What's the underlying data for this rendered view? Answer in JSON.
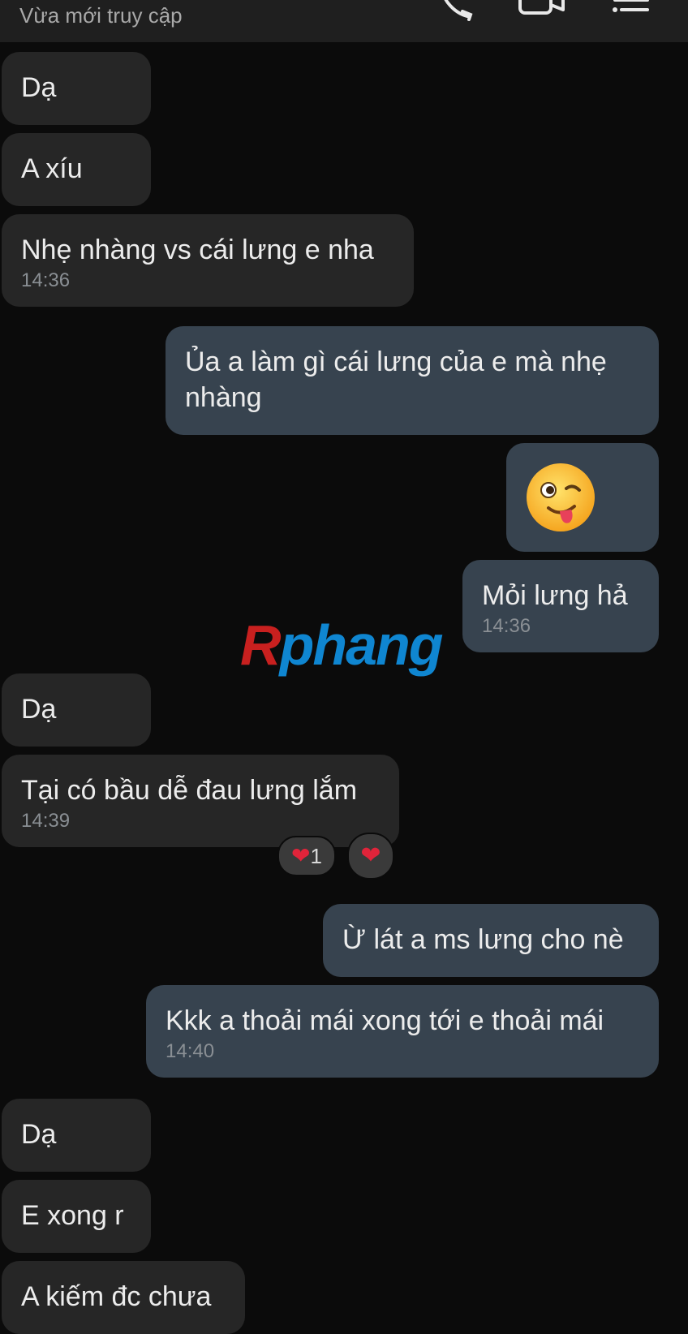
{
  "header": {
    "status": "Vừa mới truy cập",
    "icons": [
      "phone-icon",
      "video-call-icon",
      "menu-icon"
    ]
  },
  "messages": [
    {
      "id": "m1",
      "side": "in",
      "text": "Dạ"
    },
    {
      "id": "m2",
      "side": "in",
      "text": "A xíu"
    },
    {
      "id": "m3",
      "side": "in",
      "text": "Nhẹ nhàng vs cái lưng e nha",
      "time": "14:36"
    },
    {
      "id": "m4",
      "side": "out",
      "text": "Ủa a làm gì cái lưng của e mà nhẹ nhàng"
    },
    {
      "id": "m5",
      "side": "out",
      "emoji": "winking-face-with-tongue"
    },
    {
      "id": "m6",
      "side": "out",
      "text": "Mỏi lưng hả",
      "time": "14:36"
    },
    {
      "id": "m7",
      "side": "in",
      "text": "Dạ"
    },
    {
      "id": "m8",
      "side": "in",
      "text": "Tại có bầu dễ đau lưng lắm",
      "time": "14:39",
      "reactions": {
        "heart_count": "1"
      }
    },
    {
      "id": "m9",
      "side": "out",
      "text": "Ừ lát a ms lưng cho nè"
    },
    {
      "id": "m10",
      "side": "out",
      "text": "Kkk a thoải mái xong tới e thoải mái",
      "time": "14:40"
    },
    {
      "id": "m11",
      "side": "in",
      "text": "Dạ"
    },
    {
      "id": "m12",
      "side": "in",
      "text": "E xong r"
    },
    {
      "id": "m13",
      "side": "in",
      "text": "A kiếm đc chưa"
    }
  ],
  "watermark": {
    "part1": "R",
    "part2": "phang"
  },
  "colors": {
    "background": "#0b0b0b",
    "header": "#1f1f1f",
    "incoming_bubble": "#262626",
    "outgoing_bubble": "#37434f",
    "text": "#ececec",
    "timestamp": "#8a8f94",
    "heart": "#e0243a"
  }
}
